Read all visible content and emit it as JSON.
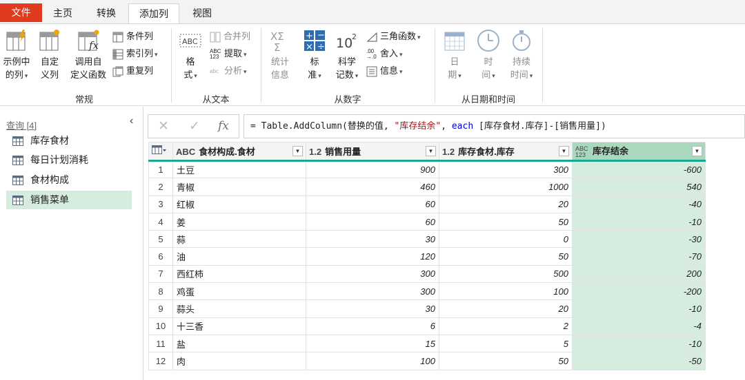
{
  "tabs": [
    "文件",
    "主页",
    "转换",
    "添加列",
    "视图"
  ],
  "ribbon": {
    "general": {
      "group_label": "常规",
      "example_col": [
        "示例中",
        "的列"
      ],
      "custom_col": [
        "自定",
        "义列"
      ],
      "invoke_func": [
        "调用自",
        "定义函数"
      ],
      "conditional_col": "条件列",
      "index_col": "索引列",
      "duplicate_col": "重复列"
    },
    "from_text": {
      "group_label": "从文本",
      "format": [
        "格",
        "式"
      ],
      "merge_cols": "合并列",
      "extract": "提取",
      "parse": "分析"
    },
    "from_number": {
      "group_label": "从数字",
      "statistics": [
        "统计",
        "信息"
      ],
      "standard": [
        "标",
        "准"
      ],
      "scientific": [
        "科学",
        "记数"
      ],
      "trig": "三角函数",
      "rounding": "舍入",
      "information": "信息"
    },
    "from_datetime": {
      "group_label": "从日期和时间",
      "date": [
        "日",
        "期"
      ],
      "time": [
        "时",
        "间"
      ],
      "duration": [
        "持续",
        "时间"
      ]
    }
  },
  "queries": {
    "header": "查询 [4]",
    "items": [
      "库存食材",
      "每日计划消耗",
      "食材构成",
      "销售菜单"
    ]
  },
  "formula": {
    "prefix": "= Table.AddColumn(替换的值, ",
    "string": "\"库存结余\"",
    "sep": ", ",
    "keyword": "each",
    "suffix": " [库存食材.库存]-[销售用量])"
  },
  "table": {
    "columns": [
      {
        "type": "ABC",
        "name": "食材构成.食材"
      },
      {
        "type": "1.2",
        "name": "销售用量"
      },
      {
        "type": "1.2",
        "name": "库存食材.库存"
      },
      {
        "type": "ABC123",
        "name": "库存结余"
      }
    ],
    "rows": [
      {
        "idx": "1",
        "c1": "土豆",
        "c2": "900",
        "c3": "300",
        "c4": "-600"
      },
      {
        "idx": "2",
        "c1": "青椒",
        "c2": "460",
        "c3": "1000",
        "c4": "540"
      },
      {
        "idx": "3",
        "c1": "红椒",
        "c2": "60",
        "c3": "20",
        "c4": "-40"
      },
      {
        "idx": "4",
        "c1": "姜",
        "c2": "60",
        "c3": "50",
        "c4": "-10"
      },
      {
        "idx": "5",
        "c1": "蒜",
        "c2": "30",
        "c3": "0",
        "c4": "-30"
      },
      {
        "idx": "6",
        "c1": "油",
        "c2": "120",
        "c3": "50",
        "c4": "-70"
      },
      {
        "idx": "7",
        "c1": "西红柿",
        "c2": "300",
        "c3": "500",
        "c4": "200"
      },
      {
        "idx": "8",
        "c1": "鸡蛋",
        "c2": "300",
        "c3": "100",
        "c4": "-200"
      },
      {
        "idx": "9",
        "c1": "蒜头",
        "c2": "30",
        "c3": "20",
        "c4": "-10"
      },
      {
        "idx": "10",
        "c1": "十三香",
        "c2": "6",
        "c3": "2",
        "c4": "-4"
      },
      {
        "idx": "11",
        "c1": "盐",
        "c2": "15",
        "c3": "5",
        "c4": "-10"
      },
      {
        "idx": "12",
        "c1": "肉",
        "c2": "100",
        "c3": "50",
        "c4": "-50"
      }
    ]
  }
}
